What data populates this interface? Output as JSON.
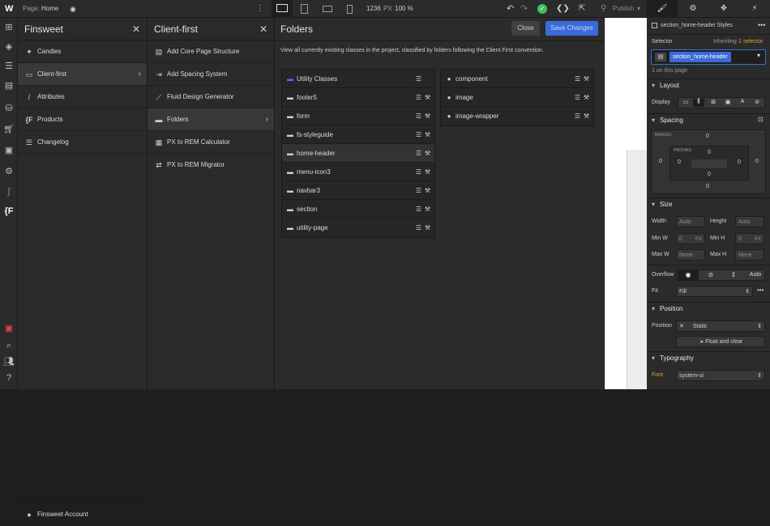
{
  "topbar": {
    "logo": "W",
    "page_label": "Page:",
    "page_name": "Home",
    "width_value": "1236",
    "width_unit": "PX",
    "zoom": "100 %",
    "publish_label": "Publish"
  },
  "rail": {
    "icons": [
      "add-icon",
      "layers-icon",
      "navigator-icon",
      "pages-icon",
      "cms-icon",
      "ecommerce-icon",
      "assets-icon",
      "settings-icon",
      "finsweet-icon",
      "fs-brackets-icon"
    ],
    "bottom_icons": [
      "record-icon",
      "search-icon",
      "users-icon",
      "help-icon"
    ]
  },
  "finsweet_panel": {
    "title": "Finsweet",
    "items": [
      {
        "label": "Candies",
        "icon": "candy-icon"
      },
      {
        "label": "Client-first",
        "icon": "client-first-icon",
        "chevron": true
      },
      {
        "label": "Attributes",
        "icon": "attributes-icon"
      },
      {
        "label": "Products",
        "icon": "products-icon"
      },
      {
        "label": "Changelog",
        "icon": "changelog-icon"
      }
    ],
    "account_label": "Finsweet Account"
  },
  "clientfirst_panel": {
    "title": "Client-first",
    "items": [
      {
        "label": "Add Core Page Structure"
      },
      {
        "label": "Add Spacing System"
      },
      {
        "label": "Fluid Design Generator"
      },
      {
        "label": "Folders",
        "chevron": true
      },
      {
        "label": "PX to REM Calculator"
      },
      {
        "label": "PX to REM Migrator"
      }
    ]
  },
  "folders_panel": {
    "title": "Folders",
    "close_label": "Close",
    "save_label": "Save Changes",
    "description": "View all currently existing classes in the project, classified by folders following the Client First convention.",
    "folders": [
      "Utility Classes",
      "footer5",
      "form",
      "fs-styleguide",
      "home-header",
      "menu-icon3",
      "navbar3",
      "section",
      "utility-page"
    ],
    "classes": [
      "component",
      "image",
      "image-wrapper"
    ]
  },
  "style_panel": {
    "selected_name": "section_home-header Styles",
    "selector_label": "Selector",
    "inheriting_text": "Inheriting",
    "inheriting_count": "1 selector",
    "selector_value": "section_home-header",
    "on_page": "1 on this page",
    "layout_title": "Layout",
    "display_label": "Display",
    "spacing_title": "Spacing",
    "margin_label": "MARGIN",
    "padding_label": "PADDING",
    "zero": "0",
    "size_title": "Size",
    "width_label": "Width",
    "height_label": "Height",
    "auto": "Auto",
    "minw_label": "Min W",
    "minh_label": "Min H",
    "px": "PX",
    "maxw_label": "Max W",
    "maxh_label": "Max H",
    "none": "None",
    "overflow_label": "Overflow",
    "overflow_auto": "Auto",
    "fit_label": "Fit",
    "fit_value": "Fill",
    "position_title": "Position",
    "position_label": "Position",
    "position_value": "Static",
    "float_label": "Float and clear",
    "typography_title": "Typography",
    "font_label": "Font",
    "font_value": "system-ui"
  }
}
